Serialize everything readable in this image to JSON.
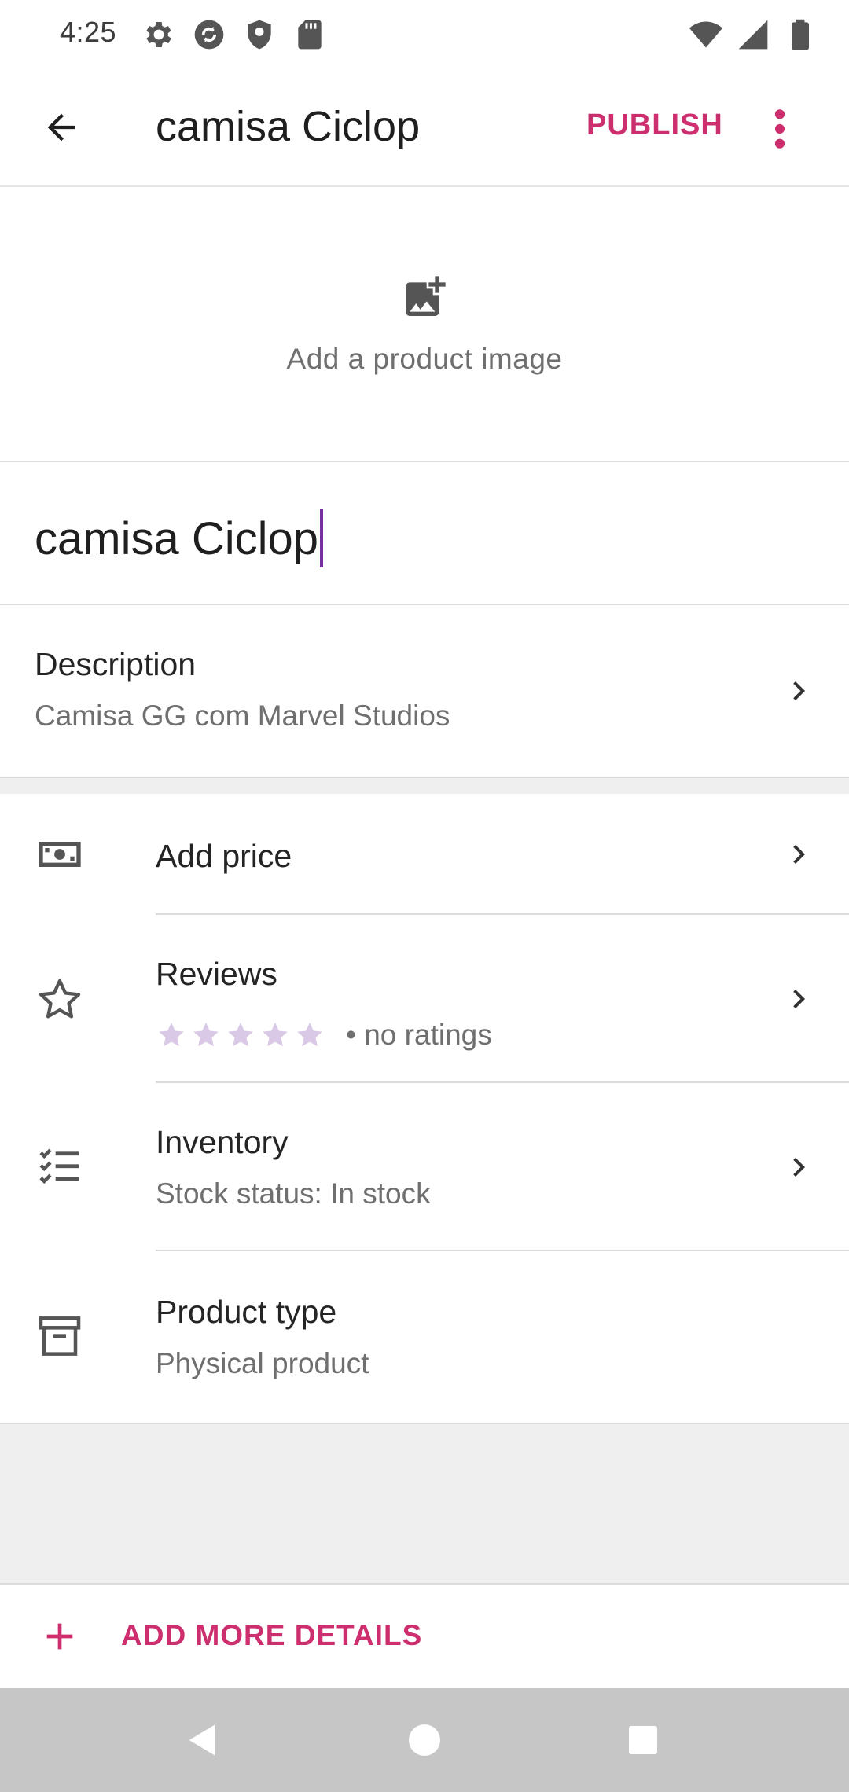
{
  "status_bar": {
    "time": "4:25",
    "left_icons": [
      "settings-icon",
      "sync-icon",
      "shield-icon",
      "sd-card-icon"
    ],
    "right_icons": [
      "wifi-icon",
      "signal-icon",
      "battery-icon"
    ]
  },
  "toolbar": {
    "title": "camisa Ciclop",
    "publish_label": "PUBLISH",
    "accent_color": "#cc2e6e"
  },
  "image_placeholder": {
    "label": "Add a product image"
  },
  "product_title_field": {
    "value": "camisa Ciclop"
  },
  "description": {
    "label": "Description",
    "value": "Camisa GG com Marvel Studios"
  },
  "rows": {
    "price": {
      "title": "Add price",
      "icon": "money-icon"
    },
    "reviews": {
      "title": "Reviews",
      "rating_text": "• no ratings",
      "stars": 5,
      "rating": 0,
      "icon": "star-icon"
    },
    "inventory": {
      "title": "Inventory",
      "subtitle": "Stock status: In stock",
      "icon": "checklist-icon"
    },
    "product_type": {
      "title": "Product type",
      "subtitle": "Physical product",
      "icon": "archive-icon"
    }
  },
  "add_more": {
    "label": "ADD MORE DETAILS"
  },
  "nav_bar": {
    "buttons": [
      "back-triangle-icon",
      "home-circle-icon",
      "recents-square-icon"
    ]
  }
}
